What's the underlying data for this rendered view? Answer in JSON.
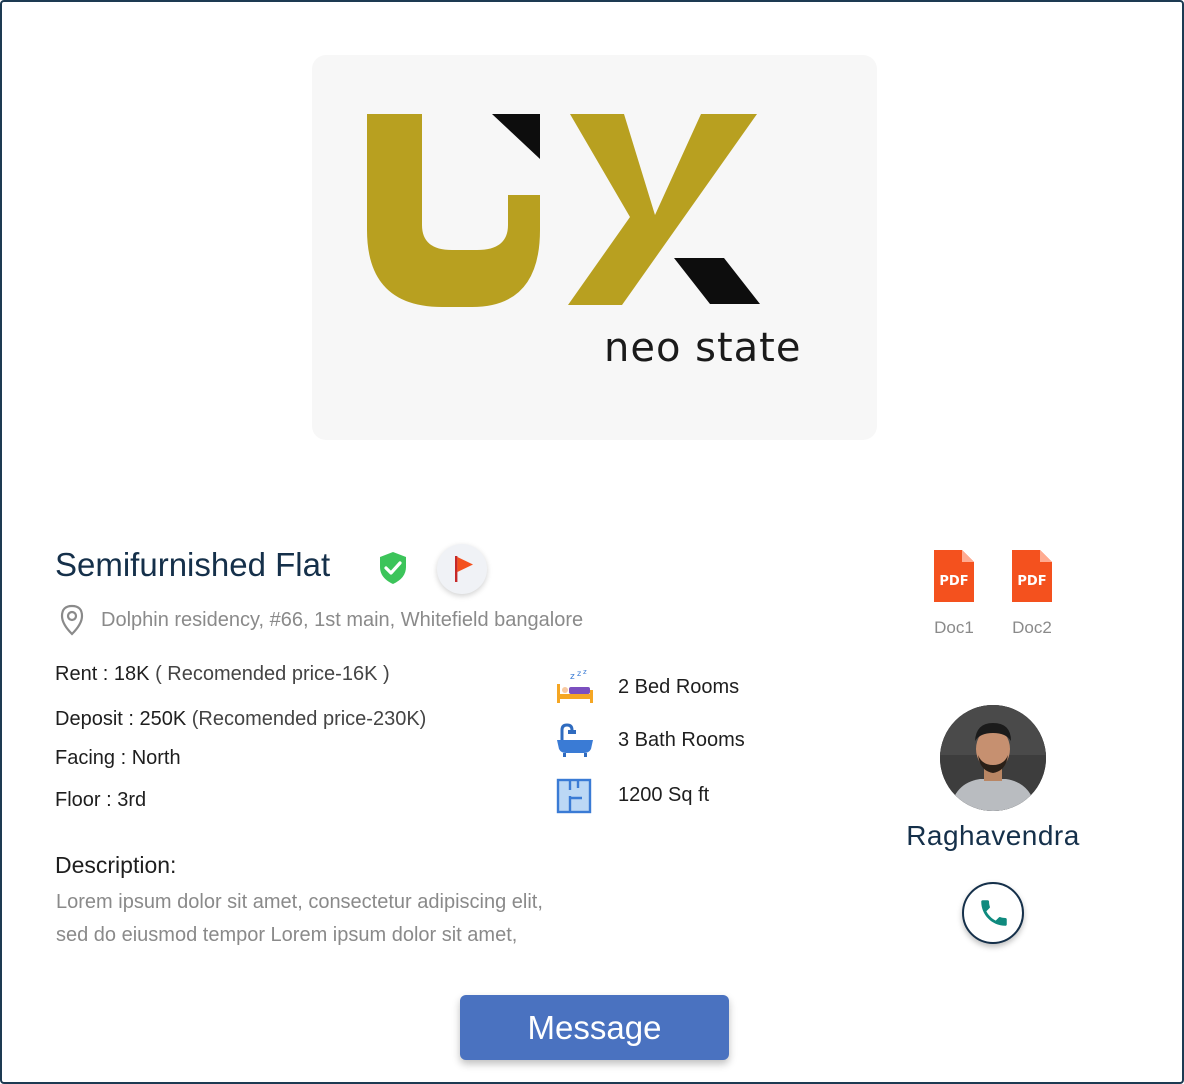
{
  "logo": {
    "tagline": "neo state",
    "colors": {
      "gold": "#b8a020",
      "black": "#0d0d0d"
    }
  },
  "listing": {
    "title": "Semifurnished Flat",
    "address": "Dolphin residency, #66, 1st main, Whitefield bangalore",
    "verified_icon": "shield-check-icon",
    "flag_icon": "flag-icon"
  },
  "details": {
    "rent_label": "Rent : 18K",
    "rent_note": "( Recomended price-16K )",
    "deposit_label": "Deposit : 250K",
    "deposit_note": "(Recomended price-230K)",
    "facing": "Facing : North",
    "floor": "Floor : 3rd"
  },
  "features": {
    "bedrooms": "2 Bed Rooms",
    "bathrooms": "3 Bath Rooms",
    "area": "1200 Sq ft"
  },
  "description": {
    "heading": "Description:",
    "line1": "Lorem ipsum dolor sit amet, consectetur adipiscing elit,",
    "line2": "sed do eiusmod tempor Lorem ipsum dolor sit amet,"
  },
  "documents": [
    {
      "label": "Doc1",
      "icon": "pdf-icon",
      "badge": "PDF"
    },
    {
      "label": "Doc2",
      "icon": "pdf-icon",
      "badge": "PDF"
    }
  ],
  "owner": {
    "name": "Raghavendra",
    "call_icon": "phone-icon"
  },
  "actions": {
    "message_label": "Message"
  },
  "colors": {
    "primary_button": "#4a72c0",
    "title_text": "#15304a",
    "pdf": "#f4511e",
    "verified": "#3cc45a"
  }
}
